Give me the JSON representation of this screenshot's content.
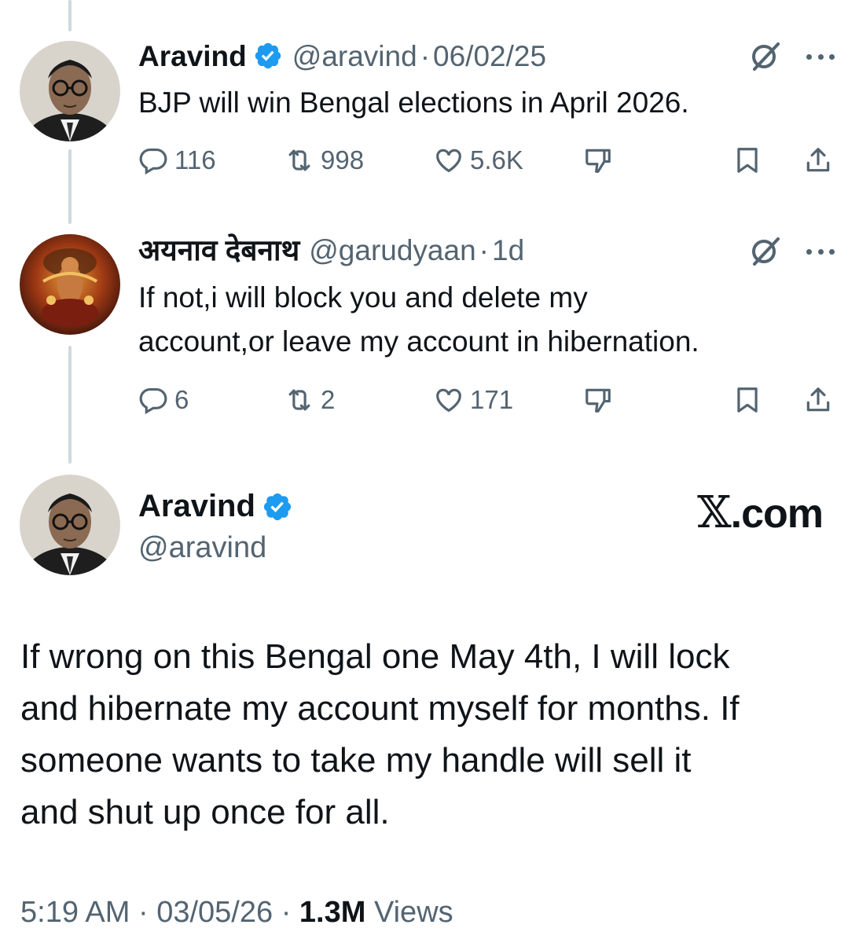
{
  "thread": {
    "first": {
      "name": "Aravind",
      "handle": "@aravind",
      "separator": "·",
      "time": "06/02/25",
      "text": "BJP will win Bengal elections in April 2026.",
      "replies": "116",
      "reposts": "998",
      "likes": "5.6K"
    },
    "second": {
      "name": "अयनाव देबनाथ",
      "handle": "@garudyaan",
      "separator": "·",
      "time": "1d",
      "text_line1": "If not,i will block you and delete my",
      "text_line2": "account,or leave my account in hibernation.",
      "replies": "6",
      "reposts": "2",
      "likes": "171"
    }
  },
  "main": {
    "name": "Aravind",
    "handle": "@aravind",
    "watermark_x": "𝕏",
    "watermark_domain": ".com",
    "text_line1": "If wrong on this Bengal one May 4th, I will lock",
    "text_line2": "and hibernate my account myself for months. If",
    "text_line3": "someone wants to take my handle will sell it",
    "text_line4": "and shut up once for all.",
    "footer_time": "5:19 AM",
    "footer_sep": "·",
    "footer_date": "03/05/26",
    "views_count": "1.3M",
    "views_label": "Views"
  },
  "colors": {
    "verified_blue": "#1d9bf0",
    "muted": "#536471",
    "thread_line": "#cfd9de",
    "text": "#0f1419"
  },
  "icons": [
    "verified-badge-icon",
    "grok-icon",
    "more-icon",
    "reply-icon",
    "repost-icon",
    "like-icon",
    "dislike-icon",
    "bookmark-icon",
    "share-icon"
  ]
}
